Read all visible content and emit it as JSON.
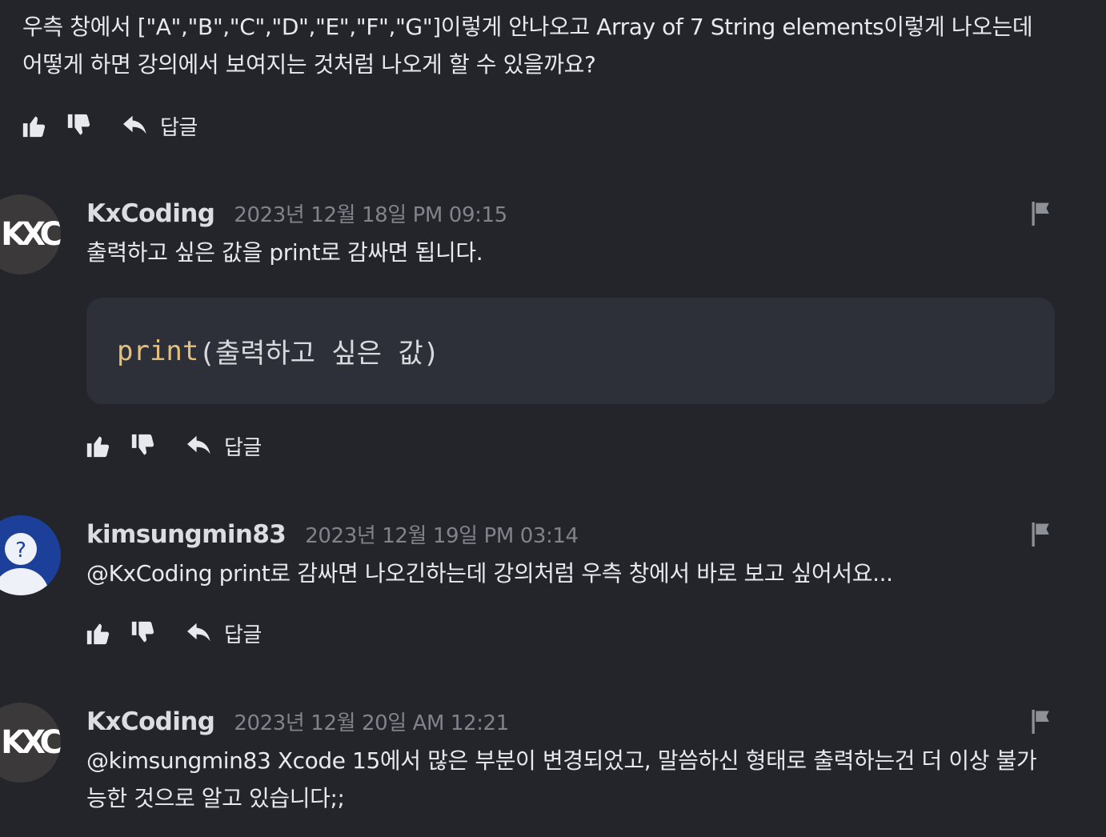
{
  "question": {
    "text": "우측 창에서 [\"A\",\"B\",\"C\",\"D\",\"E\",\"F\",\"G\"]이렇게 안나오고 Array of 7 String elements이렇게 나오는데 어떻게 하면 강의에서 보여지는 것처럼 나오게 할 수 있을까요?",
    "reply_label": "답글"
  },
  "icons": {
    "like": "thumbs-up-icon",
    "dislike": "thumbs-down-icon",
    "reply": "reply-arrow-icon",
    "report": "flag-icon"
  },
  "comments": [
    {
      "author": "KxCoding",
      "avatar_text": "KXC",
      "date": "2023년 12월 18일 PM 09:15",
      "text": "출력하고 싶은 값을 print로 감싸면 됩니다.",
      "code": {
        "fn": "print",
        "args": "(출력하고 싶은 값)"
      },
      "reply_label": "답글"
    },
    {
      "author": "kimsungmin83",
      "date": "2023년 12월 19일 PM 03:14",
      "text": "@KxCoding print로 감싸면 나오긴하는데 강의처럼 우측 창에서 바로 보고 싶어서요...",
      "reply_label": "답글"
    },
    {
      "author": "KxCoding",
      "avatar_text": "KXC",
      "date": "2023년 12월 20일 AM 12:21",
      "text": "@kimsungmin83 Xcode 15에서 많은 부분이 변경되었고, 말씀하신 형태로 출력하는건 더 이상 불가능한 것으로 알고 있습니다;;"
    }
  ],
  "colors": {
    "background": "#23252a",
    "code_background": "#2d3038",
    "code_function": "#e5c07b",
    "muted_text": "#80838b",
    "default_avatar": "#1c3f99"
  }
}
